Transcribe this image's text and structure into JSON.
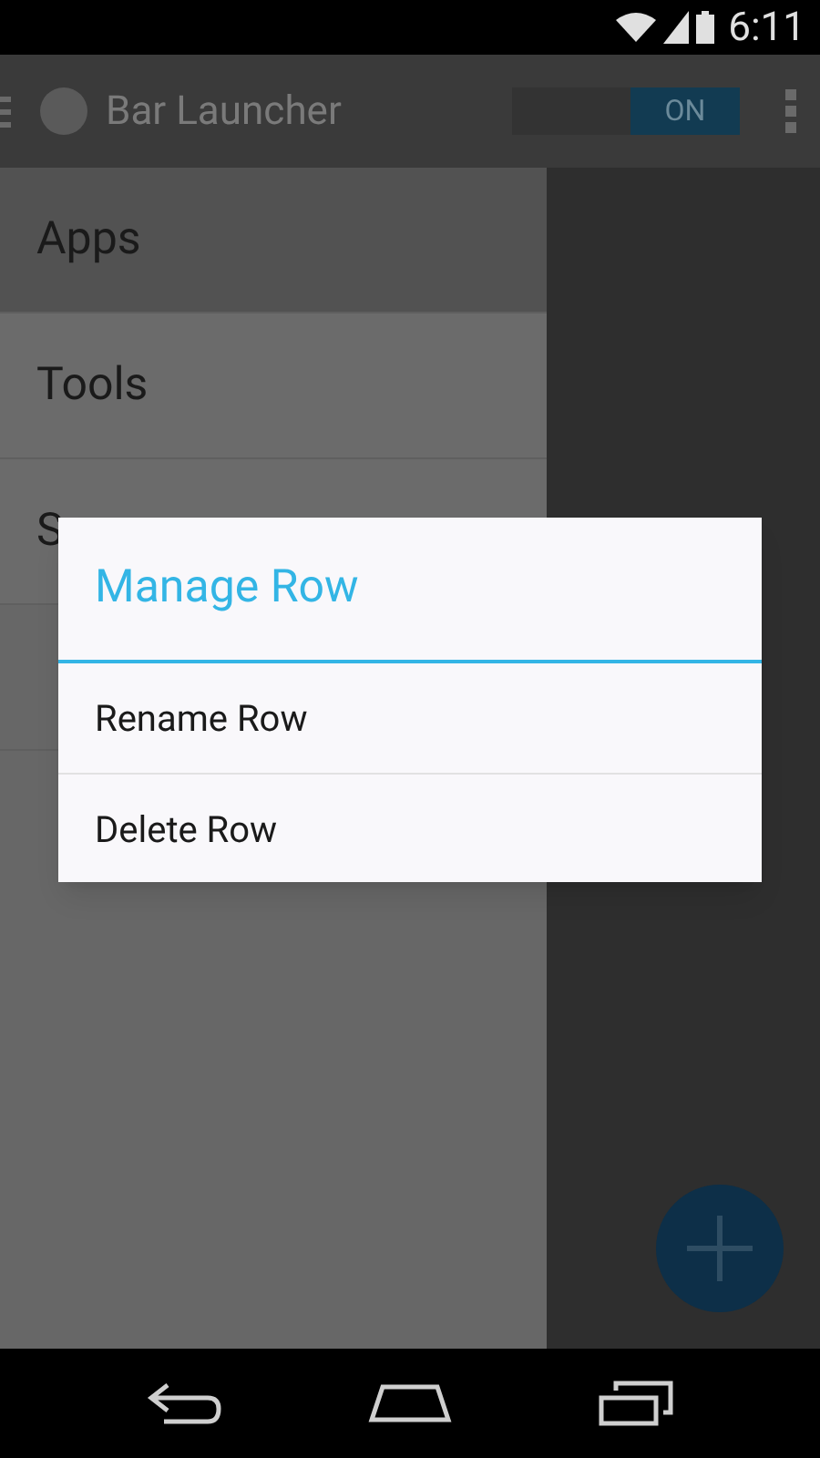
{
  "status_bar": {
    "time": "6:11"
  },
  "action_bar": {
    "title": "Bar Launcher",
    "toggle": {
      "label": "ON",
      "on": true
    }
  },
  "drawer": {
    "items": [
      {
        "label": "Apps",
        "selected": true
      },
      {
        "label": "Tools",
        "selected": false
      },
      {
        "label": "S",
        "selected": false
      }
    ]
  },
  "dialog": {
    "title": "Manage Row",
    "items": [
      "Rename Row",
      "Delete Row"
    ]
  }
}
